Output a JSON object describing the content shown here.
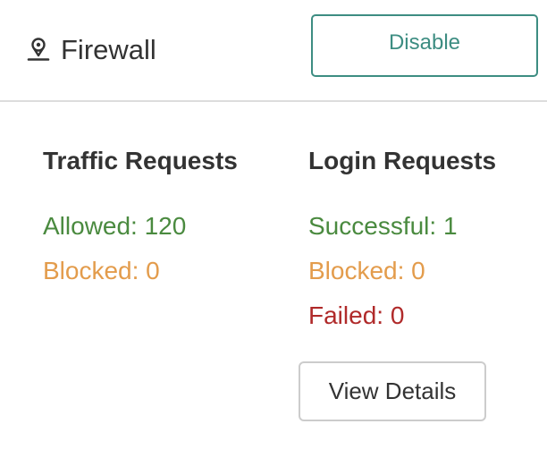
{
  "header": {
    "title": "Firewall",
    "icon": "firewall-pin-icon",
    "disable_label": "Disable"
  },
  "traffic": {
    "title": "Traffic Requests",
    "allowed": "Allowed: 120",
    "blocked": "Blocked: 0"
  },
  "login": {
    "title": "Login Requests",
    "successful": "Successful: 1",
    "blocked": "Blocked: 0",
    "failed": "Failed: 0"
  },
  "actions": {
    "view_details_label": "View Details"
  },
  "colors": {
    "accent": "#3d8d82",
    "allowed": "#4a8a3f",
    "blocked": "#e39c4c",
    "failed": "#b02a2a"
  }
}
